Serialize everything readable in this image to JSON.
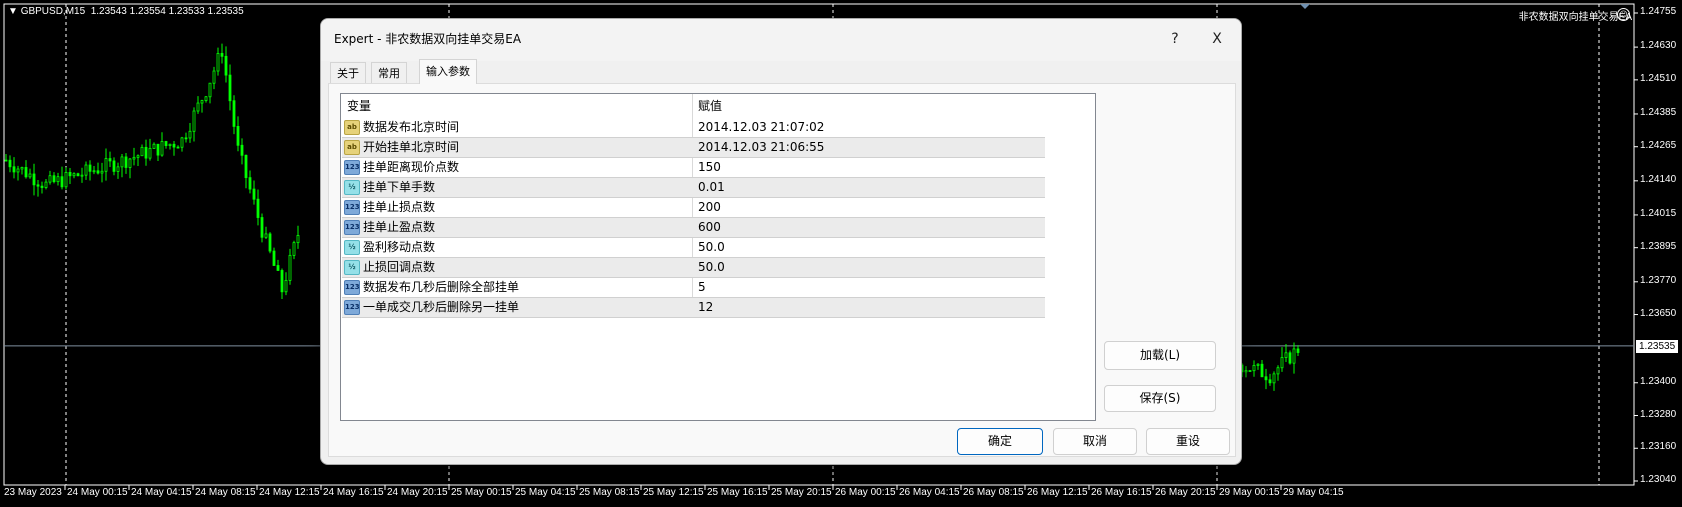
{
  "chart": {
    "symbol_label": "GBPUSD,M15",
    "ohlc": "1.23543 1.23554 1.23533 1.23535",
    "ea_label": "非农数据双向挂单交易EA",
    "ea_icon": "smiley-icon",
    "current_price": "1.23535",
    "candle_color": "#00ff00",
    "background": "#000000"
  },
  "chart_data": {
    "type": "candlestick",
    "y_ticks": [
      "1.24755",
      "1.24630",
      "1.24510",
      "1.24385",
      "1.24265",
      "1.24140",
      "1.24015",
      "1.23895",
      "1.23770",
      "1.23650",
      "1.23400",
      "1.23280",
      "1.23160",
      "1.23040"
    ],
    "ylim": [
      1.2304,
      1.24755
    ],
    "x_ticks": [
      "23 May 2023",
      "24 May 00:15",
      "24 May 04:15",
      "24 May 08:15",
      "24 May 12:15",
      "24 May 16:15",
      "24 May 20:15",
      "25 May 00:15",
      "25 May 04:15",
      "25 May 08:15",
      "25 May 12:15",
      "25 May 16:15",
      "25 May 20:15",
      "26 May 00:15",
      "26 May 04:15",
      "26 May 08:15",
      "26 May 12:15",
      "26 May 16:15",
      "26 May 20:15",
      "29 May 00:15",
      "29 May 04:15"
    ],
    "approx_close_path_left": [
      [
        0,
        1.24216
      ],
      [
        10,
        1.24125
      ],
      [
        26,
        1.24198
      ],
      [
        44,
        1.2429
      ],
      [
        50,
        1.24473
      ],
      [
        54,
        1.24619
      ],
      [
        58,
        1.24253
      ],
      [
        64,
        1.2396
      ],
      [
        69,
        1.2374
      ],
      [
        74,
        1.23996
      ]
    ],
    "approx_close_path_right": [
      [
        309,
        1.23465
      ],
      [
        316,
        1.23428
      ],
      [
        320,
        1.23483
      ],
      [
        324,
        1.23538
      ]
    ]
  },
  "dialog": {
    "title": "Expert - 非农数据双向挂单交易EA",
    "help": "?",
    "close": "X",
    "tabs": [
      {
        "label": "关于"
      },
      {
        "label": "常用"
      },
      {
        "label": "输入参数",
        "active": true
      }
    ],
    "columns": {
      "variable": "变量",
      "value": "赋值"
    },
    "params": [
      {
        "type": "ab",
        "icon": "string-type-icon",
        "name": "数据发布北京时间",
        "value": "2014.12.03 21:07:02"
      },
      {
        "type": "ab",
        "icon": "string-type-icon",
        "name": "开始挂单北京时间",
        "value": "2014.12.03 21:06:55"
      },
      {
        "type": "123",
        "icon": "integer-type-icon",
        "name": "挂单距离现价点数",
        "value": "150"
      },
      {
        "type": "½",
        "icon": "double-type-icon",
        "name": "挂单下单手数",
        "value": "0.01"
      },
      {
        "type": "123",
        "icon": "integer-type-icon",
        "name": "挂单止损点数",
        "value": "200"
      },
      {
        "type": "123",
        "icon": "integer-type-icon",
        "name": "挂单止盈点数",
        "value": "600"
      },
      {
        "type": "½",
        "icon": "double-type-icon",
        "name": "盈利移动点数",
        "value": "50.0"
      },
      {
        "type": "½",
        "icon": "double-type-icon",
        "name": "止损回调点数",
        "value": "50.0"
      },
      {
        "type": "123",
        "icon": "integer-type-icon",
        "name": "数据发布几秒后删除全部挂单",
        "value": "5"
      },
      {
        "type": "123",
        "icon": "integer-type-icon",
        "name": "一单成交几秒后删除另一挂单",
        "value": "12"
      }
    ],
    "load_button": "加载(L)",
    "save_button": "保存(S)",
    "ok_button": "确定",
    "cancel_button": "取消",
    "reset_button": "重设"
  }
}
